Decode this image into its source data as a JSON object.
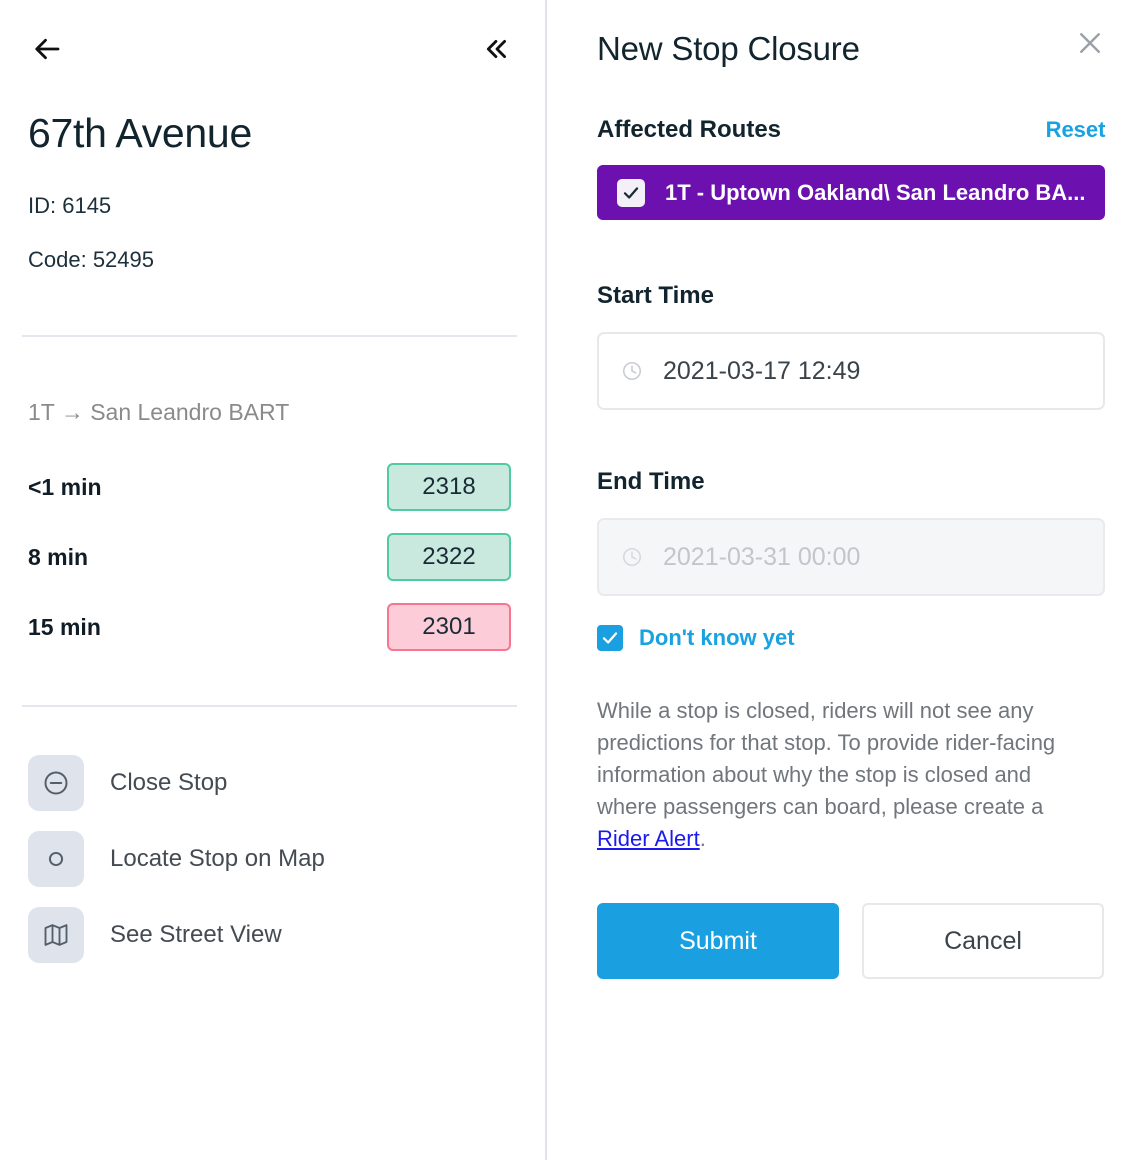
{
  "left_panel": {
    "back_icon": "arrow-left-icon",
    "collapse_icon": "chevron-double-left-icon",
    "stop_name": "67th Avenue",
    "id_line": "ID: 6145",
    "code_line": "Code: 52495",
    "route_header": "1T → San Leandro BART",
    "predictions": [
      {
        "eta": "<1 min",
        "vehicle": "2318",
        "status": "ontime"
      },
      {
        "eta": "8 min",
        "vehicle": "2322",
        "status": "ontime"
      },
      {
        "eta": "15 min",
        "vehicle": "2301",
        "status": "late"
      }
    ],
    "actions": [
      {
        "label": "Close Stop",
        "icon": "minus-circle-icon"
      },
      {
        "label": "Locate Stop on Map",
        "icon": "map-pin-circle-icon"
      },
      {
        "label": "See Street View",
        "icon": "map-icon"
      }
    ]
  },
  "right_panel": {
    "title": "New Stop Closure",
    "close_icon": "close-icon",
    "affected_routes": {
      "section_label": "Affected Routes",
      "reset_label": "Reset",
      "route_chip": {
        "label": "1T - Uptown Oakland\\ San Leandro BA...",
        "checked": true,
        "color": "#6c11b0"
      }
    },
    "start_time": {
      "label": "Start Time",
      "value": "2021-03-17 12:49",
      "icon": "clock-icon",
      "disabled": false
    },
    "end_time": {
      "label": "End Time",
      "value": "2021-03-31 00:00",
      "icon": "clock-icon",
      "disabled": true
    },
    "dont_know_yet": {
      "label": "Don't know yet",
      "checked": true
    },
    "info_text_before": "While a stop is closed, riders will not see any predictions for that stop. To provide rider-facing information about why the stop is closed and where passengers can board, please create a ",
    "info_link": "Rider Alert",
    "info_text_after": ".",
    "submit_label": "Submit",
    "cancel_label": "Cancel"
  },
  "colors": {
    "accent_blue": "#1aa0e0",
    "route_purple": "#6c11b0",
    "ontime_bg": "#c9e9de",
    "ontime_border": "#4fcaa2",
    "late_bg": "#fccdd8",
    "late_border": "#f87590",
    "link_blue": "#1a1aee",
    "title_navy": "#12242e"
  }
}
